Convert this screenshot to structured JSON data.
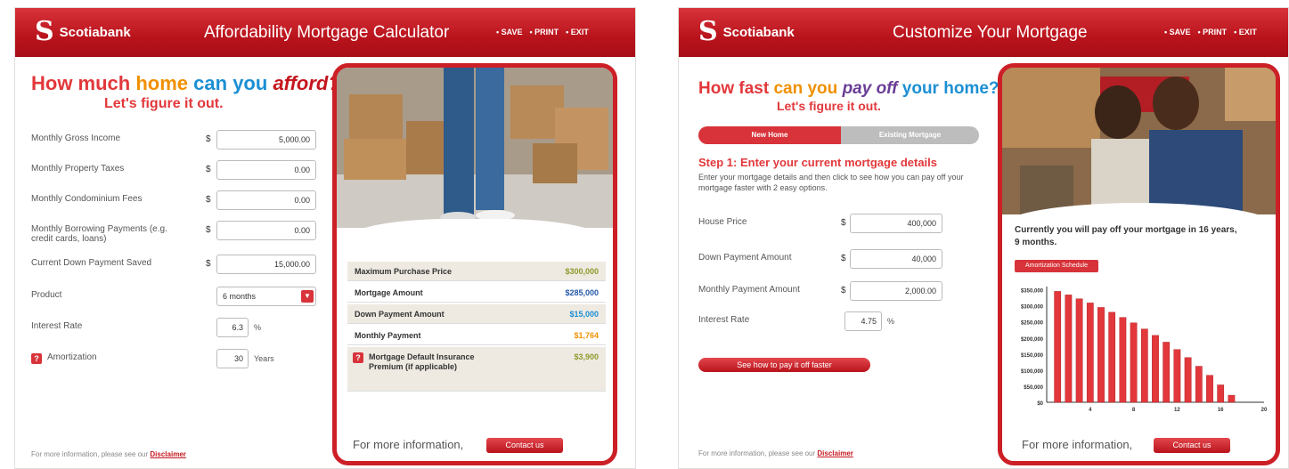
{
  "left": {
    "brand": "Scotiabank",
    "title": "Affordability Mortgage Calculator",
    "links": [
      "• SAVE",
      "• PRINT",
      "• EXIT"
    ],
    "headline": {
      "w1": "How much",
      "w2": "home",
      "w3": "can you",
      "w4": "afford?",
      "sub": "Let's figure it out."
    },
    "fields": [
      {
        "label": "Monthly Gross Income",
        "value": "5,000.00"
      },
      {
        "label": "Monthly Property Taxes",
        "value": "0.00"
      },
      {
        "label": "Monthly Condominium Fees",
        "value": "0.00"
      },
      {
        "label": "Monthly Borrowing Payments (e.g. credit cards, loans)",
        "value": "0.00"
      },
      {
        "label": "Current Down Payment Saved",
        "value": "15,000.00"
      }
    ],
    "currency": "$",
    "product": {
      "label": "Product",
      "value": "6 months"
    },
    "interest": {
      "label": "Interest Rate",
      "value": "6.3",
      "unit": "%"
    },
    "amortization": {
      "label": "Amortization",
      "value": "30",
      "unit": "Years"
    },
    "results": [
      {
        "label": "Maximum Purchase Price",
        "value": "$300,000",
        "color": "#8f9a2b"
      },
      {
        "label": "Mortgage Amount",
        "value": "$285,000",
        "color": "#2457a8"
      },
      {
        "label": "Down Payment Amount",
        "value": "$15,000",
        "color": "#1c8fd3"
      },
      {
        "label": "Monthly Payment",
        "value": "$1,764",
        "color": "#f09000"
      },
      {
        "label": "Mortgage Default Insurance Premium (if applicable)",
        "value": "$3,900",
        "color": "#8f9a2b"
      }
    ],
    "info": "For more information,",
    "contact": "Contact us",
    "footer": "For more information, please see our",
    "disclaimer": "Disclaimer"
  },
  "right": {
    "brand": "Scotiabank",
    "title": "Customize Your Mortgage",
    "links": [
      "• SAVE",
      "• PRINT",
      "• EXIT"
    ],
    "headline": {
      "w1": "How fast",
      "w2": "can you",
      "w3": "pay off",
      "w4": "your home?",
      "sub": "Let's figure it out."
    },
    "tabs": [
      "New Home",
      "Existing Mortgage"
    ],
    "step_title": "Step 1: Enter your current mortgage details",
    "step_desc": "Enter your mortgage details and then click to see how you can pay off your mortgage faster with 2 easy options.",
    "currency": "$",
    "fields": [
      {
        "label": "House Price",
        "value": "400,000"
      },
      {
        "label": "Down Payment Amount",
        "value": "40,000"
      },
      {
        "label": "Monthly Payment Amount",
        "value": "2,000.00"
      }
    ],
    "interest": {
      "label": "Interest Rate",
      "value": "4.75",
      "unit": "%"
    },
    "cta": "See how to pay it off faster",
    "payoff": "Currently you will pay off your mortgage in 16 years, 9 months.",
    "schedule_btn": "Amortization Schedule",
    "info": "For more information,",
    "contact": "Contact us",
    "footer": "For more information, please see our",
    "disclaimer": "Disclaimer"
  },
  "chart_data": {
    "type": "bar",
    "x": [
      1,
      2,
      3,
      4,
      5,
      6,
      7,
      8,
      9,
      10,
      11,
      12,
      13,
      14,
      15,
      16,
      17
    ],
    "values": [
      345000,
      334000,
      322000,
      309000,
      295000,
      280000,
      264000,
      247000,
      228000,
      208000,
      187000,
      164000,
      139000,
      112000,
      84000,
      54000,
      22000
    ],
    "ytick_labels": [
      "$0",
      "$50,000",
      "$100,000",
      "$150,000",
      "$200,000",
      "$250,000",
      "$300,000",
      "$350,000"
    ],
    "xtick_labels": [
      "4",
      "8",
      "12",
      "16",
      "20"
    ],
    "ylim": [
      0,
      360000
    ],
    "xlim": [
      0,
      20
    ],
    "color": "#e2383b"
  }
}
